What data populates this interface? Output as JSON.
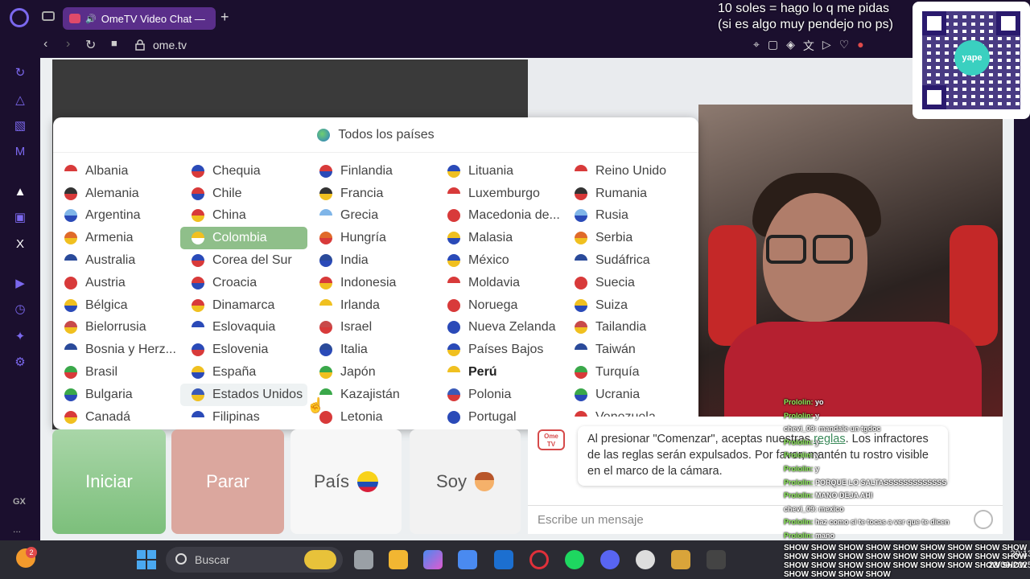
{
  "browser": {
    "tab_title": "OmeTV Video Chat —",
    "url": "ome.tv",
    "new_tab": "+",
    "sidebar_gx": "GX",
    "sidebar_more": "..."
  },
  "overlay": {
    "line1": "10 soles = hago lo q me pidas",
    "line2": "(si es algo muy pendejo no ps)",
    "qr_badge": "yape"
  },
  "country_picker": {
    "header": "Todos los países",
    "columns": [
      [
        "Albania",
        "Alemania",
        "Argentina",
        "Armenia",
        "Australia",
        "Austria",
        "Bélgica",
        "Bielorrusia",
        "Bosnia y Herz...",
        "Brasil",
        "Bulgaria",
        "Canadá"
      ],
      [
        "Chequia",
        "Chile",
        "China",
        "Colombia",
        "Corea del Sur",
        "Croacia",
        "Dinamarca",
        "Eslovaquia",
        "Eslovenia",
        "España",
        "Estados Unidos",
        "Filipinas"
      ],
      [
        "Finlandia",
        "Francia",
        "Grecia",
        "Hungría",
        "India",
        "Indonesia",
        "Irlanda",
        "Israel",
        "Italia",
        "Japón",
        "Kazajistán",
        "Letonia"
      ],
      [
        "Lituania",
        "Luxemburgo",
        "Macedonia de...",
        "Malasia",
        "México",
        "Moldavia",
        "Noruega",
        "Nueva Zelanda",
        "Países Bajos",
        "Perú",
        "Polonia",
        "Portugal"
      ],
      [
        "Reino Unido",
        "Rumania",
        "Rusia",
        "Serbia",
        "Sudáfrica",
        "Suecia",
        "Suiza",
        "Tailandia",
        "Taiwán",
        "Turquía",
        "Ucrania",
        "Venezuela"
      ]
    ],
    "selected": "Colombia",
    "hovered": "Estados Unidos",
    "bold": "Perú"
  },
  "controls": {
    "start": "Iniciar",
    "stop": "Parar",
    "country": "País",
    "me": "Soy"
  },
  "chat": {
    "logo": "Ome TV",
    "notice_pre": "Al presionar \"Comenzar\", aceptas nuestras ",
    "notice_link": "reglas",
    "notice_post": ". Los infractores de las reglas serán expulsados. Por favor, mantén tu rostro visible en el marco de la cámara.",
    "input_placeholder": "Escribe un mensaje"
  },
  "stream_chat": [
    {
      "user": "Prololin:",
      "text": "yo"
    },
    {
      "user": "Prololin:",
      "text": "y"
    },
    {
      "user": "chevi_09:",
      "text": "mandale un tgdoc"
    },
    {
      "user": "Prololin:",
      "text": "y"
    },
    {
      "user": "Prololin:",
      "text": "y"
    },
    {
      "user": "Prololin:",
      "text": "y"
    },
    {
      "user": "Prololin:",
      "text": "PORQUE LO SALTASSSSSSSSSSSSS"
    },
    {
      "user": "Prololin:",
      "text": "MANO DEJA AHI"
    },
    {
      "user": "chevi_09:",
      "text": "mexico"
    },
    {
      "user": "Prololin:",
      "text": "haz como si te tocas a ver que te dicen"
    },
    {
      "user": "Prololin:",
      "text": "mano"
    }
  ],
  "show_text": "SHOW SHOW SHOW SHOW SHOW SHOW SHOW SHOW SHOW SHOW SHOW SHOW SHOW SHOW SHOW SHOW SHOW SHOW SHOW SHOW SHOW SHOW SHOW SHOW SHOW SHOW SHOW SHOW SHOW SHOW SHOW",
  "taskbar": {
    "search_placeholder": "Buscar",
    "weather_badge": "2",
    "time": "20:13",
    "date": "23/09/2025"
  }
}
